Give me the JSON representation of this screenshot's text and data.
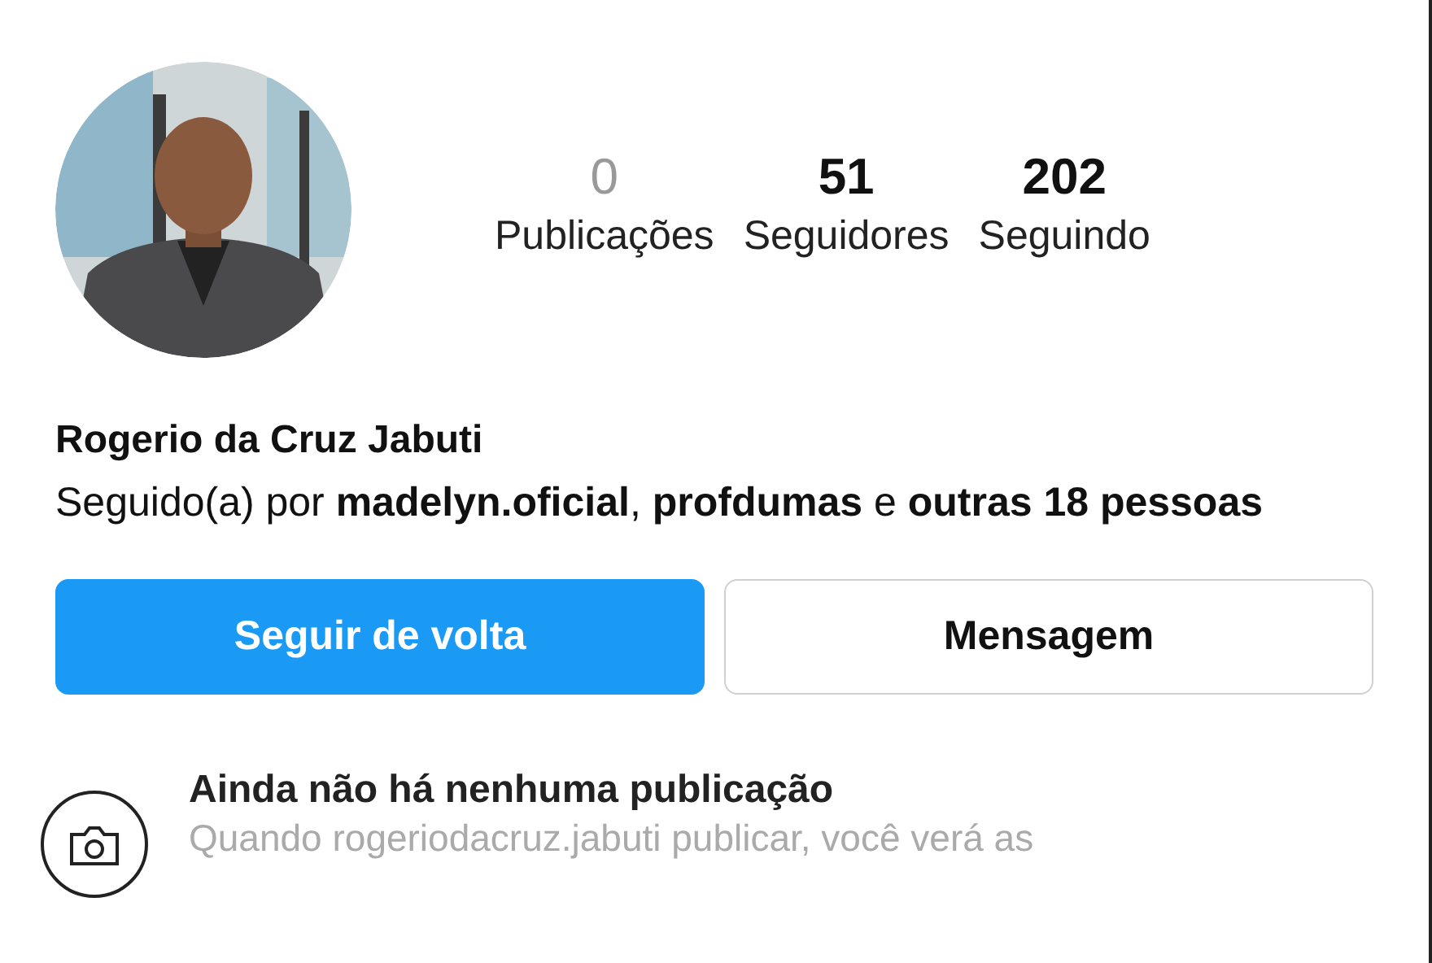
{
  "profile": {
    "stats": [
      {
        "value": "0",
        "label": "Publicações",
        "disabled": true
      },
      {
        "value": "51",
        "label": "Seguidores",
        "disabled": false
      },
      {
        "value": "202",
        "label": "Seguindo",
        "disabled": false
      }
    ],
    "name": "Rogerio da Cruz Jabuti",
    "followed_by": "Seguido(a) por **madelyn.oficial**, **profdumas** e **outras 18 pessoas**"
  },
  "buttons": [
    {
      "label": "Seguir de volta",
      "kind": "primary"
    },
    {
      "label": "Mensagem",
      "kind": "secondary"
    }
  ],
  "empty_state": {
    "title": "Ainda não há nenhuma publicação",
    "text": "Quando rogeriodacruz.jabuti publicar, você verá as"
  }
}
